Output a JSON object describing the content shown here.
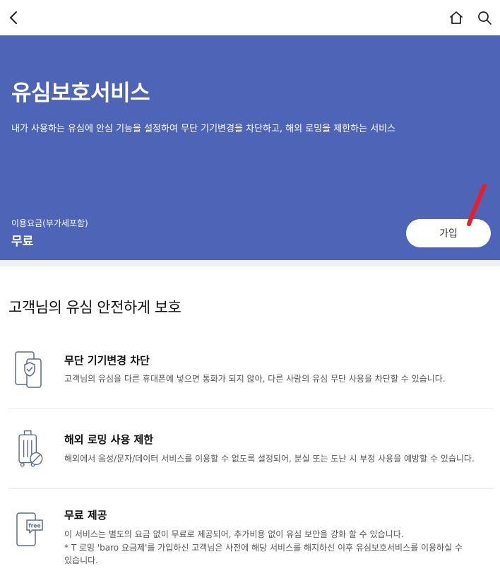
{
  "header": {
    "icons": [
      "back-icon",
      "home-icon",
      "search-icon"
    ]
  },
  "hero": {
    "title": "유심보호서비스",
    "description": "내가 사용하는 유심에 안심 기능을 설정하여 무단 기기변경을 차단하고, 해외 로밍을 제한하는 서비스",
    "fee_label": "이용요금(부가세포함)",
    "fee_value": "무료",
    "join_label": "가입",
    "background_color": "#4d64b7",
    "annotation_color": "#ee1c25"
  },
  "section": {
    "title": "고객님의 유심 안전하게 보호"
  },
  "features": [
    {
      "icon": "phone-shield-icon",
      "title": "무단 기기변경 차단",
      "desc_line1": "고객님의 유심을 다른 휴대폰에 넣으면 통화가 되지 않아, 다른 사람의 유심 무단 사용을 차단할 수 있습니다."
    },
    {
      "icon": "luggage-blocked-icon",
      "title": "해외 로밍 사용 제한",
      "desc_line1": "해외에서 음성/문자/데이터 서비스를 이용할 수 없도록 설정되어, 분실 또는 도난 시 부정 사용을 예방할 수 있습니다."
    },
    {
      "icon": "phone-free-icon",
      "icon_badge": "free",
      "title": "무료 제공",
      "desc_line1": "이 서비스는 별도의 요금 없이 무료로 제공되어, 추가비용 없이 유심 보안을 강화 할 수 있습니다.",
      "desc_line2": "* T 로밍 'baro 요금제'를 가입하신 고객님은 사전에 해당 서비스를 해지하신 이후 유심보호서비스를 이용하실 수",
      "desc_line3": "있습니다."
    }
  ]
}
